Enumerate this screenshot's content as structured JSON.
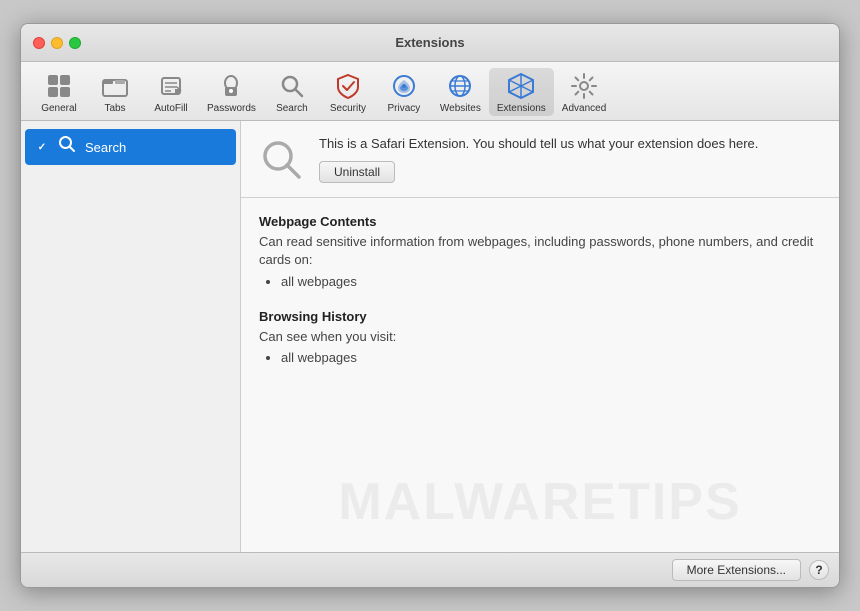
{
  "window": {
    "title": "Extensions"
  },
  "traffic_lights": {
    "close": "close",
    "minimize": "minimize",
    "maximize": "maximize"
  },
  "toolbar": {
    "items": [
      {
        "id": "general",
        "label": "General",
        "icon": "general"
      },
      {
        "id": "tabs",
        "label": "Tabs",
        "icon": "tabs"
      },
      {
        "id": "autofill",
        "label": "AutoFill",
        "icon": "autofill"
      },
      {
        "id": "passwords",
        "label": "Passwords",
        "icon": "passwords"
      },
      {
        "id": "search",
        "label": "Search",
        "icon": "search"
      },
      {
        "id": "security",
        "label": "Security",
        "icon": "security"
      },
      {
        "id": "privacy",
        "label": "Privacy",
        "icon": "privacy"
      },
      {
        "id": "websites",
        "label": "Websites",
        "icon": "websites"
      },
      {
        "id": "extensions",
        "label": "Extensions",
        "icon": "extensions",
        "active": true
      },
      {
        "id": "advanced",
        "label": "Advanced",
        "icon": "advanced"
      }
    ]
  },
  "sidebar": {
    "items": [
      {
        "id": "search-ext",
        "label": "Search",
        "checked": true,
        "selected": true
      }
    ]
  },
  "extension": {
    "description": "This is a Safari Extension. You should tell us what your extension does here.",
    "uninstall_label": "Uninstall",
    "permissions": [
      {
        "title": "Webpage Contents",
        "desc": "Can read sensitive information from webpages, including passwords, phone numbers, and credit cards on:",
        "items": [
          "all webpages"
        ]
      },
      {
        "title": "Browsing History",
        "desc": "Can see when you visit:",
        "items": [
          "all webpages"
        ]
      }
    ]
  },
  "footer": {
    "more_extensions_label": "More Extensions...",
    "help_label": "?"
  },
  "watermark": {
    "text": "MALWARETIPS"
  }
}
